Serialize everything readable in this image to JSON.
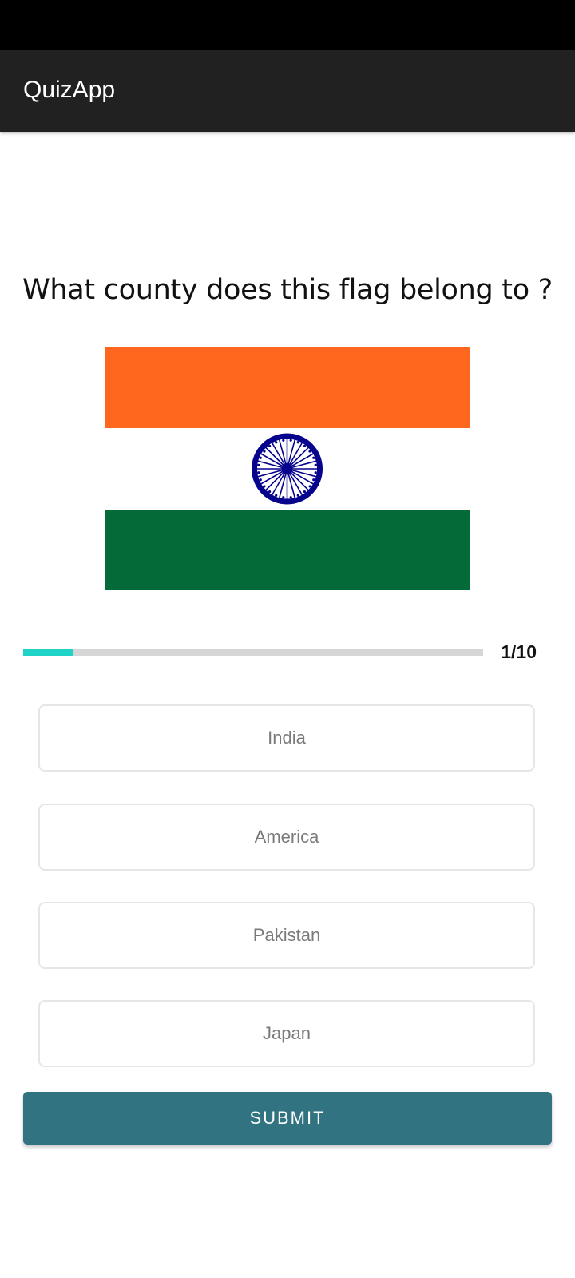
{
  "app_bar": {
    "title": "QuizApp"
  },
  "question": {
    "text": "What county does this flag belong to ?",
    "flag_icon": "india-flag-icon",
    "flag_colors": {
      "saffron": "#FF671F",
      "white": "#FFFFFF",
      "green": "#046A38",
      "chakra": "#06038D"
    }
  },
  "progress": {
    "current": 1,
    "total": 10,
    "label": "1/10",
    "fill_color": "#1FD3C6",
    "track_color": "#D6D6D6"
  },
  "options": [
    {
      "label": "India"
    },
    {
      "label": "America"
    },
    {
      "label": "Pakistan"
    },
    {
      "label": "Japan"
    }
  ],
  "submit": {
    "label": "SUBMIT",
    "color": "#317380"
  }
}
